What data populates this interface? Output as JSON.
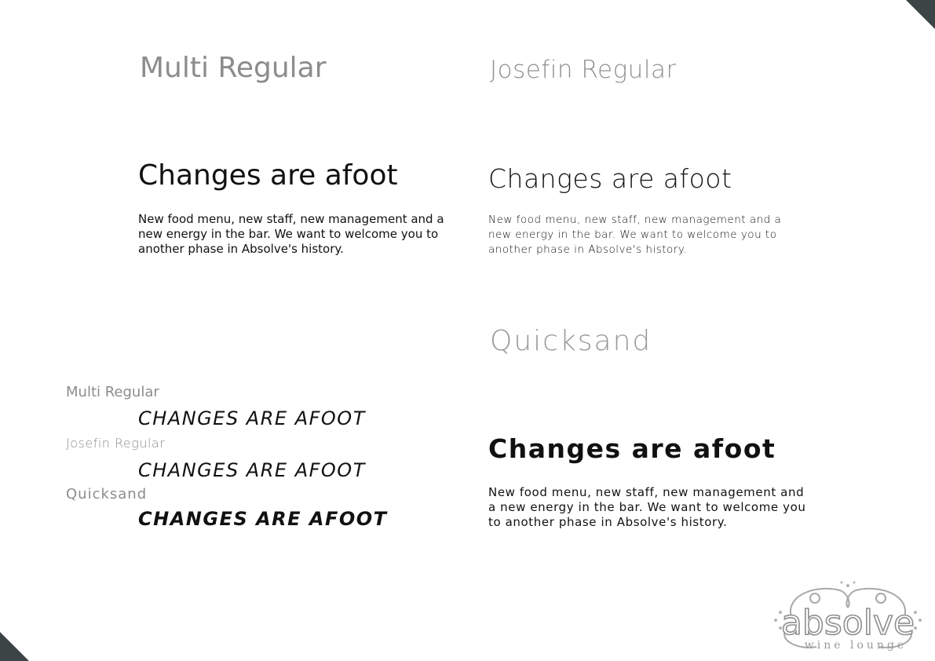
{
  "colors": {
    "corner": "#3d4446",
    "label_gray": "#8c8c8c",
    "text": "#111111",
    "logo_gray": "#a0a0a0"
  },
  "multi": {
    "name": "Multi Regular",
    "heading": "Changes are afoot",
    "body": "New food menu, new staff, new management and a new energy in the bar. We want to welcome you to another phase in Absolve's history."
  },
  "josefin": {
    "name": "Josefin Regular",
    "heading": "Changes are afoot",
    "body": "New food menu, new staff, new management and a new energy in the bar. We want to welcome you to another phase in Absolve's history."
  },
  "quicksand": {
    "name": "Quicksand",
    "heading": "Changes are afoot",
    "body": "New food menu, new staff, new management and a new energy in the bar. We want to welcome you to another phase in Absolve's history."
  },
  "comparison": [
    {
      "name": "Multi Regular",
      "sample": "CHANGES ARE AFOOT"
    },
    {
      "name": "Josefin Regular",
      "sample": "CHANGES ARE AFOOT"
    },
    {
      "name": "Quicksand",
      "sample": "CHANGES ARE AFOOT"
    }
  ],
  "logo": {
    "brand": "absolve",
    "tagline": "wine lounge"
  }
}
